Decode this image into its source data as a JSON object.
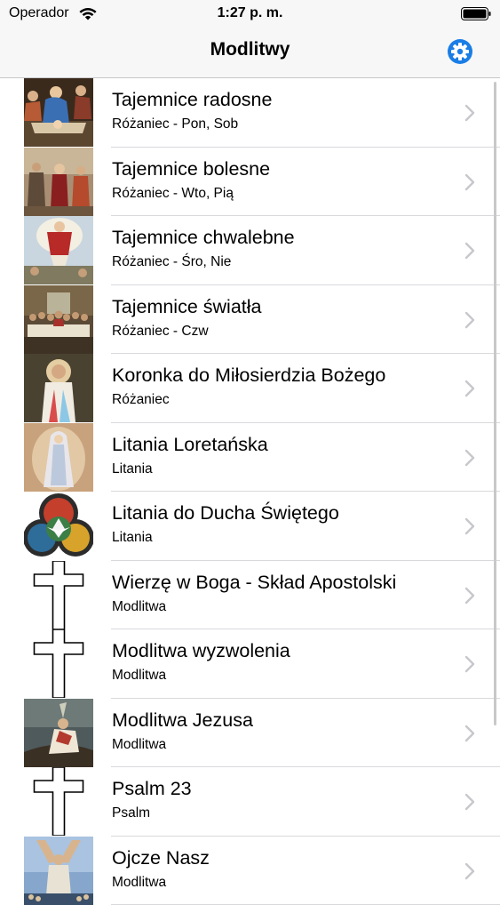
{
  "status_bar": {
    "carrier": "Operador",
    "time": "1:27 p. m."
  },
  "nav": {
    "title": "Modlitwy",
    "settings_icon": "gear-icon"
  },
  "accent_color": "#1a7ee6",
  "items": [
    {
      "title": "Tajemnice radosne",
      "subtitle": "Różaniec - Pon, Sob",
      "image": "nativity-painting"
    },
    {
      "title": "Tajemnice bolesne",
      "subtitle": "Różaniec - Wto, Pią",
      "image": "passion-painting"
    },
    {
      "title": "Tajemnice chwalebne",
      "subtitle": "Różaniec - Śro, Nie",
      "image": "resurrection-painting"
    },
    {
      "title": "Tajemnice światła",
      "subtitle": "Różaniec - Czw",
      "image": "last-supper-painting"
    },
    {
      "title": "Koronka do Miłosierdzia Bożego",
      "subtitle": "Różaniec",
      "image": "divine-mercy-painting"
    },
    {
      "title": "Litania Loretańska",
      "subtitle": "Litania",
      "image": "virgin-mary-painting"
    },
    {
      "title": "Litania do Ducha Świętego",
      "subtitle": "Litania",
      "image": "holy-spirit-stained-glass"
    },
    {
      "title": "Wierzę w Boga - Skład Apostolski",
      "subtitle": "Modlitwa",
      "image": "cross-icon"
    },
    {
      "title": "Modlitwa wyzwolenia",
      "subtitle": "Modlitwa",
      "image": "cross-icon"
    },
    {
      "title": "Modlitwa Jezusa",
      "subtitle": "Modlitwa",
      "image": "praying-jesus-painting"
    },
    {
      "title": "Psalm 23",
      "subtitle": "Psalm",
      "image": "cross-icon"
    },
    {
      "title": "Ojcze Nasz",
      "subtitle": "Modlitwa",
      "image": "jesus-arms-raised-painting"
    }
  ]
}
